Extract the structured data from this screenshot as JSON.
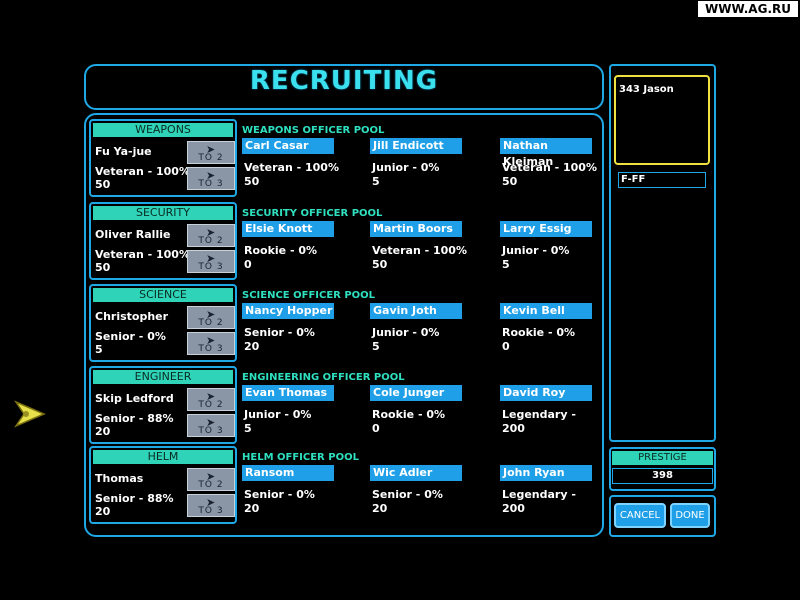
{
  "watermark": "WWW.AG.RU",
  "title": "RECRUITING",
  "to2_label": "TO 2",
  "to3_label": "TO 3",
  "roles": [
    {
      "header": "WEAPONS",
      "officer": {
        "name": "Fu Ya-jue",
        "level": "Veteran - 100%",
        "points": "50"
      },
      "pool_title": "WEAPONS OFFICER POOL",
      "candidates": [
        {
          "name": "Carl Casar",
          "level": "Veteran - 100%",
          "points": "50"
        },
        {
          "name": "Jill Endicott",
          "level": "Junior - 0%",
          "points": "5"
        },
        {
          "name": "Nathan Kleiman",
          "level": "Veteran - 100%",
          "points": "50"
        }
      ]
    },
    {
      "header": "SECURITY",
      "officer": {
        "name": "Oliver Rallie",
        "level": "Veteran - 100%",
        "points": "50"
      },
      "pool_title": "SECURITY OFFICER POOL",
      "candidates": [
        {
          "name": "Elsie Knott",
          "level": "Rookie - 0%",
          "points": "0"
        },
        {
          "name": "Martin Boors",
          "level": "Veteran - 100%",
          "points": "50"
        },
        {
          "name": "Larry Essig",
          "level": "Junior - 0%",
          "points": "5"
        }
      ]
    },
    {
      "header": "SCIENCE",
      "officer": {
        "name": "Christopher",
        "level": "Senior - 0%",
        "points": "5"
      },
      "pool_title": "SCIENCE OFFICER POOL",
      "candidates": [
        {
          "name": "Nancy Hopper",
          "level": "Senior - 0%",
          "points": "20"
        },
        {
          "name": "Gavin Joth",
          "level": "Junior - 0%",
          "points": "5"
        },
        {
          "name": "Kevin Bell",
          "level": "Rookie - 0%",
          "points": "0"
        }
      ]
    },
    {
      "header": "ENGINEER",
      "officer": {
        "name": "Skip Ledford",
        "level": "Senior - 88%",
        "points": "20"
      },
      "pool_title": "ENGINEERING OFFICER POOL",
      "candidates": [
        {
          "name": "Evan Thomas",
          "level": "Junior - 0%",
          "points": "5"
        },
        {
          "name": "Cole Junger",
          "level": "Rookie - 0%",
          "points": "0"
        },
        {
          "name": "David Roy",
          "level": "Legendary -",
          "points": "200"
        }
      ]
    },
    {
      "header": "HELM",
      "officer": {
        "name": "Thomas",
        "level": "Senior - 88%",
        "points": "20"
      },
      "pool_title": "HELM OFFICER POOL",
      "candidates": [
        {
          "name": "Ransom",
          "level": "Senior - 0%",
          "points": "20"
        },
        {
          "name": "Wic Adler",
          "level": "Senior - 0%",
          "points": "20"
        },
        {
          "name": "John Ryan",
          "level": "Legendary -",
          "points": "200"
        }
      ]
    }
  ],
  "side": {
    "selected": "343 Jason",
    "code": "F-FF",
    "prestige_label": "PRESTIGE",
    "prestige_value": "398",
    "cancel": "CANCEL",
    "done": "DONE"
  },
  "colors": {
    "frame": "#1fa8e6",
    "accent": "#2fd4b8",
    "name_bg": "#1e9fe8",
    "highlight": "#f0e040"
  }
}
